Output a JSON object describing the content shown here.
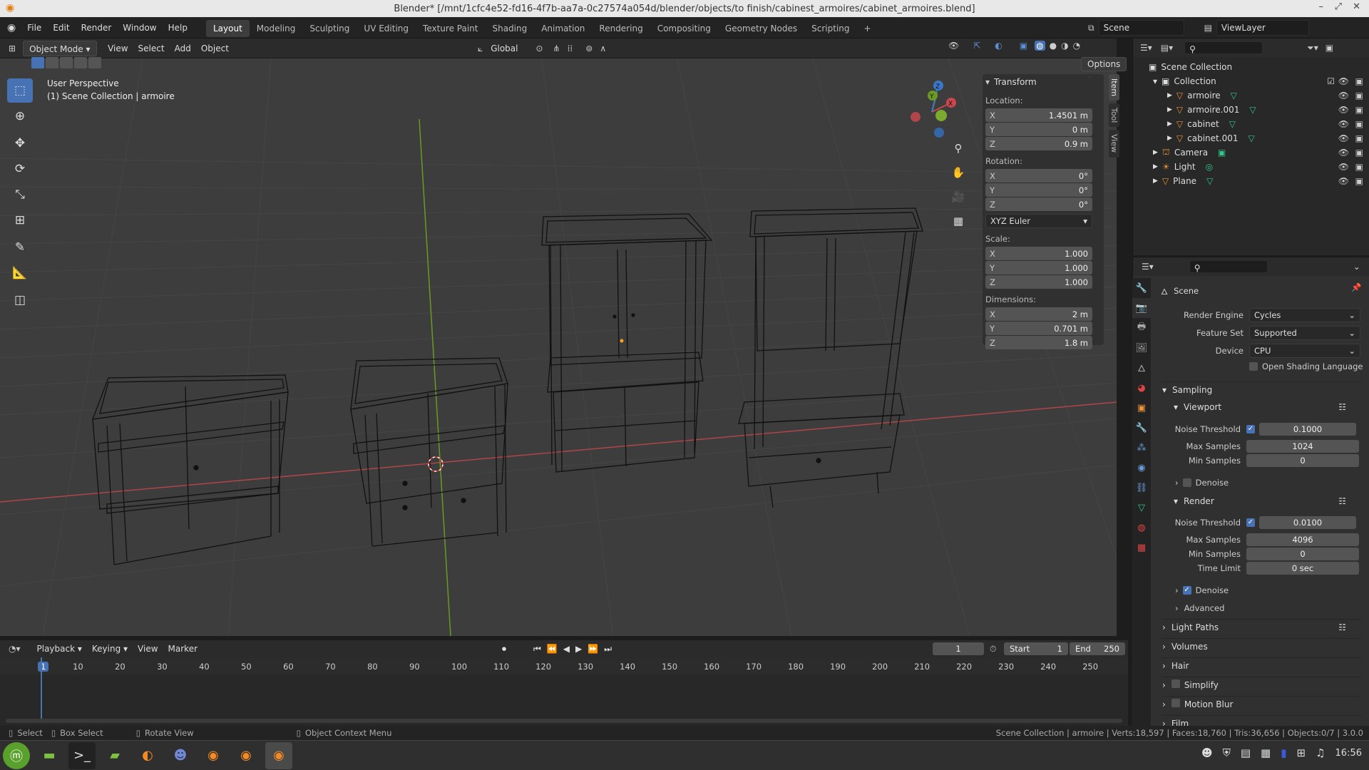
{
  "window": {
    "title": "Blender* [/mnt/1cfc4e52-fd16-4f7b-aa7a-0c27574a054d/blender/objects/to finish/cabinest_armoires/cabinet_armoires.blend]"
  },
  "menu": {
    "items": [
      "File",
      "Edit",
      "Render",
      "Window",
      "Help"
    ]
  },
  "workspaces": {
    "tabs": [
      "Layout",
      "Modeling",
      "Sculpting",
      "UV Editing",
      "Texture Paint",
      "Shading",
      "Animation",
      "Rendering",
      "Compositing",
      "Geometry Nodes",
      "Scripting"
    ],
    "active": "Layout"
  },
  "scene": {
    "name": "Scene",
    "view_layer": "ViewLayer"
  },
  "viewport_header": {
    "mode": "Object Mode",
    "menus": [
      "View",
      "Select",
      "Add",
      "Object"
    ],
    "orientation": "Global",
    "options": "Options"
  },
  "viewport": {
    "perspective": "User Perspective",
    "context": "(1) Scene Collection | armoire"
  },
  "gizmo": {
    "x": "X",
    "y": "Y",
    "z": "Z"
  },
  "transform": {
    "title": "Transform",
    "location_label": "Location:",
    "location": {
      "x": "1.4501 m",
      "y": "0 m",
      "z": "0.9 m"
    },
    "rotation_label": "Rotation:",
    "rotation": {
      "x": "0°",
      "y": "0°",
      "z": "0°"
    },
    "rotation_mode": "XYZ Euler",
    "scale_label": "Scale:",
    "scale": {
      "x": "1.000",
      "y": "1.000",
      "z": "1.000"
    },
    "dimensions_label": "Dimensions:",
    "dimensions": {
      "x": "2 m",
      "y": "0.701 m",
      "z": "1.8 m"
    },
    "axes": {
      "x": "X",
      "y": "Y",
      "z": "Z"
    }
  },
  "side_tabs": [
    "Item",
    "Tool",
    "View"
  ],
  "outliner": {
    "root": "Scene Collection",
    "collection": "Collection",
    "items": [
      "armoire",
      "armoire.001",
      "cabinet",
      "cabinet.001"
    ],
    "top_items": [
      "Camera",
      "Light",
      "Plane"
    ]
  },
  "properties": {
    "scene_label": "Scene",
    "render_engine_label": "Render Engine",
    "render_engine": "Cycles",
    "feature_set_label": "Feature Set",
    "feature_set": "Supported",
    "device_label": "Device",
    "device": "CPU",
    "osl_label": "Open Shading Language",
    "sampling": "Sampling",
    "viewport": "Viewport",
    "noise_threshold_label": "Noise Threshold",
    "viewport_noise_threshold": "0.1000",
    "max_samples_label": "Max Samples",
    "viewport_max_samples": "1024",
    "min_samples_label": "Min Samples",
    "viewport_min_samples": "0",
    "denoise_label": "Denoise",
    "render": "Render",
    "render_noise_threshold": "0.0100",
    "render_max_samples": "4096",
    "render_min_samples": "0",
    "time_limit_label": "Time Limit",
    "time_limit": "0 sec",
    "advanced": "Advanced",
    "light_paths": "Light Paths",
    "volumes": "Volumes",
    "hair": "Hair",
    "simplify": "Simplify",
    "motion_blur": "Motion Blur",
    "film": "Film"
  },
  "timeline": {
    "menus": [
      "Playback",
      "Keying",
      "View",
      "Marker"
    ],
    "current_frame": "1",
    "start_label": "Start",
    "start": "1",
    "end_label": "End",
    "end": "250",
    "ticks": [
      "1",
      "10",
      "20",
      "30",
      "40",
      "50",
      "60",
      "70",
      "80",
      "90",
      "100",
      "110",
      "120",
      "130",
      "140",
      "150",
      "160",
      "170",
      "180",
      "190",
      "200",
      "210",
      "220",
      "230",
      "240",
      "250"
    ]
  },
  "status": {
    "select": "Select",
    "box_select": "Box Select",
    "rotate_view": "Rotate View",
    "context_menu": "Object Context Menu",
    "stats": "Scene Collection | armoire | Verts:18,597 | Faces:18,760 | Tris:36,656 | Objects:0/7 | 3.0.0"
  },
  "taskbar": {
    "clock": "16:56"
  },
  "colors": {
    "accent": "#4772b3",
    "x_axis": "#c9474d",
    "y_axis": "#6a9a24",
    "z_axis": "#3b78c9"
  }
}
